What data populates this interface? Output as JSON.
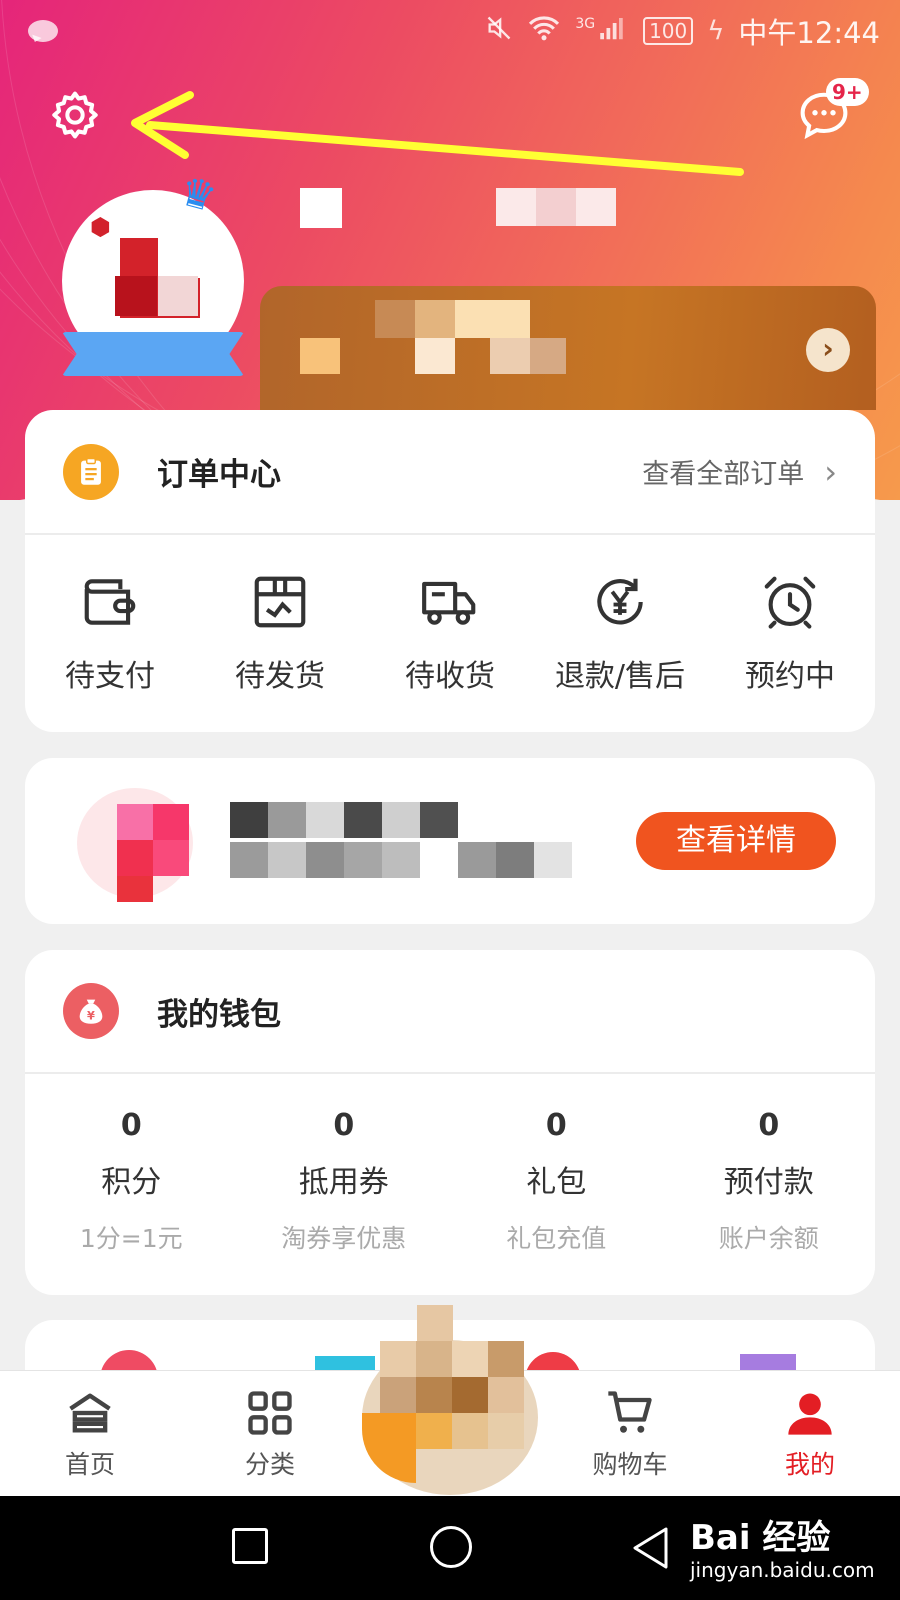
{
  "status_bar": {
    "network": "3G",
    "battery": "100",
    "time": "中午12:44"
  },
  "header": {
    "settings_icon": "gear-icon",
    "messages_icon": "chat-bubble-icon",
    "message_badge": "9+",
    "arrow_color": "#ffff33"
  },
  "orders": {
    "title": "订单中心",
    "view_all": "查看全部订单",
    "items": [
      {
        "label": "待支付",
        "icon": "wallet-icon"
      },
      {
        "label": "待发货",
        "icon": "package-icon"
      },
      {
        "label": "待收货",
        "icon": "truck-icon"
      },
      {
        "label": "退款/售后",
        "icon": "refund-icon"
      },
      {
        "label": "预约中",
        "icon": "alarm-clock-icon"
      }
    ]
  },
  "promo": {
    "button_label": "查看详情",
    "button_color": "#f0541f"
  },
  "wallet": {
    "title": "我的钱包",
    "items": [
      {
        "value": "0",
        "label": "积分",
        "sub": "1分=1元"
      },
      {
        "value": "0",
        "label": "抵用券",
        "sub": "淘券享优惠"
      },
      {
        "value": "0",
        "label": "礼包",
        "sub": "礼包充值"
      },
      {
        "value": "0",
        "label": "预付款",
        "sub": "账户余额"
      }
    ]
  },
  "bottom_nav": {
    "items": [
      {
        "label": "首页",
        "icon": "home-icon"
      },
      {
        "label": "分类",
        "icon": "grid-icon"
      },
      {
        "label": "购物车",
        "icon": "cart-icon"
      },
      {
        "label": "我的",
        "icon": "person-icon",
        "active": true
      }
    ],
    "active_color": "#e31e24"
  },
  "watermark": {
    "brand": "Bai 经验",
    "url": "jingyan.baidu.com"
  }
}
